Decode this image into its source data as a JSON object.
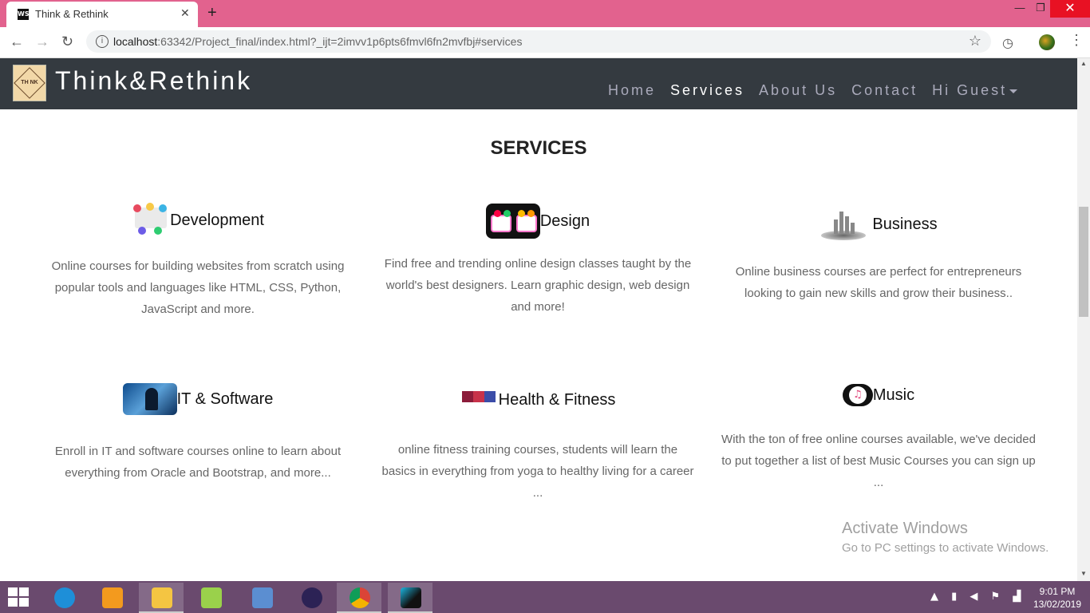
{
  "browser": {
    "tab_title": "Think & Rethink",
    "tab_favicon_text": "WS",
    "url_host": "localhost",
    "url_rest": ":63342/Project_final/index.html?_ijt=2imvv1p6pts6fmvl6fn2mvfbj#services"
  },
  "site": {
    "logo_text": "TH NK",
    "brand": "Think&Rethink",
    "nav": {
      "home": "Home",
      "services": "Services",
      "about": "About Us",
      "contact": "Contact",
      "user": "Hi Guest"
    }
  },
  "services": {
    "title": "SERVICES",
    "items": [
      {
        "label": "Development",
        "icon": "development-icon",
        "description": "Online courses for building websites from scratch using popular tools and languages like HTML, CSS, Python, JavaScript and more."
      },
      {
        "label": "Design",
        "icon": "design-glasses-icon",
        "description": "Find free and trending online design classes taught by the world's best designers. Learn graphic design, web design and more!"
      },
      {
        "label": "Business",
        "icon": "business-city-icon",
        "description": "Online business courses are perfect for entrepreneurs looking to gain new skills and grow their business.."
      },
      {
        "label": "IT & Software",
        "icon": "it-software-icon",
        "description": "Enroll in IT and software courses online to learn about everything from Oracle and Bootstrap, and more..."
      },
      {
        "label": "Health & Fitness",
        "icon": "puzzle-icon",
        "description": "online fitness training courses, students will learn the basics in everything from yoga to healthy living for a career ..."
      },
      {
        "label": "Music",
        "icon": "music-note-icon",
        "description": "With the ton of free online courses available, we've decided to put together a list of best Music Courses you can sign up ..."
      }
    ]
  },
  "watermark": {
    "line1": "Activate Windows",
    "line2": "Go to PC settings to activate Windows."
  },
  "taskbar": {
    "time": "9:01 PM",
    "date": "13/02/2019"
  }
}
